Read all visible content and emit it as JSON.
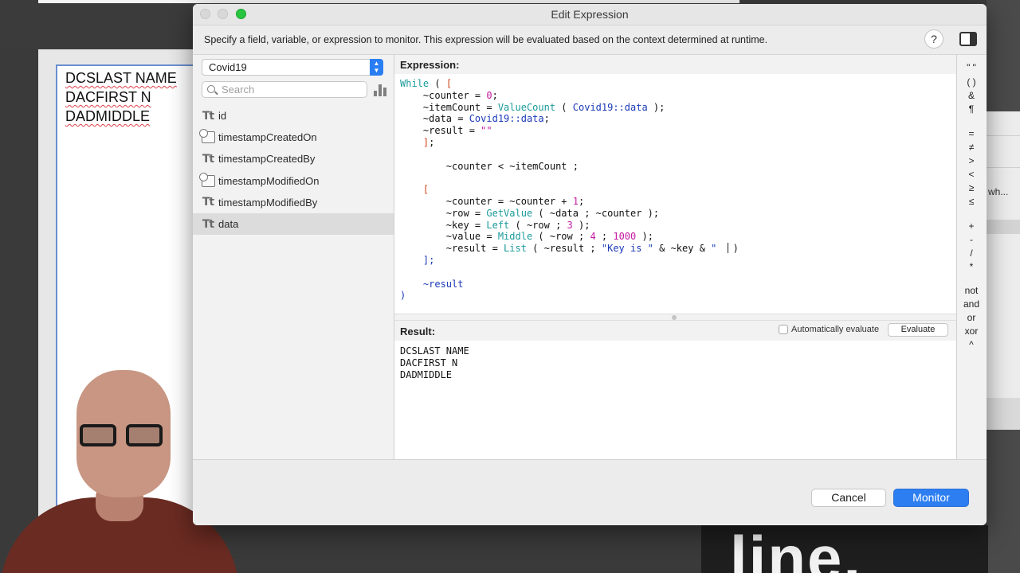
{
  "background": {
    "layout_lines": [
      "DCSLAST NAME",
      "DACFIRST N",
      "DADMIDDLE"
    ],
    "right_panel_text": "wh...",
    "big_text": "line."
  },
  "dialog": {
    "title": "Edit Expression",
    "instructions": "Specify a field, variable, or expression to monitor. This expression will be evaluated based on the context determined at runtime.",
    "help_label": "?",
    "table_selector": {
      "value": "Covid19"
    },
    "search": {
      "placeholder": "Search"
    },
    "fields": [
      {
        "name": "id",
        "type": "text",
        "selected": false
      },
      {
        "name": "timestampCreatedOn",
        "type": "timestamp",
        "selected": false
      },
      {
        "name": "timestampCreatedBy",
        "type": "text",
        "selected": false
      },
      {
        "name": "timestampModifiedOn",
        "type": "timestamp",
        "selected": false
      },
      {
        "name": "timestampModifiedBy",
        "type": "text",
        "selected": false
      },
      {
        "name": "data",
        "type": "text",
        "selected": true
      }
    ],
    "field_type_glyph": "Tt",
    "expression_label": "Expression:",
    "result_label": "Result:",
    "auto_evaluate_label": "Automatically evaluate",
    "auto_evaluate_checked": false,
    "evaluate_button": "Evaluate",
    "result_lines": [
      "DCSLAST NAME",
      "DACFIRST N",
      "DADMIDDLE"
    ],
    "operators": [
      "\" \"",
      "( )",
      "&",
      "¶",
      "=",
      "≠",
      ">",
      "<",
      "≥",
      "≤",
      "+",
      "-",
      "/",
      "*",
      "not",
      "and",
      "or",
      "xor",
      "^"
    ],
    "cancel_button": "Cancel",
    "monitor_button": "Monitor",
    "accent_color": "#2d7ff1"
  },
  "code_tokens": {
    "l1_while": "While",
    "l1_paren": " ( ",
    "l1_bracket": "[",
    "l2_a": "    ~counter = ",
    "l2_num": "0",
    "l2_b": ";",
    "l3_a": "    ~itemCount = ",
    "l3_fn": "ValueCount",
    "l3_b": " ( ",
    "l3_field": "Covid19::data",
    "l3_c": " );",
    "l4_a": "    ~data = ",
    "l4_field": "Covid19::data",
    "l4_b": ";",
    "l5_a": "    ~result = ",
    "l5_str": "\"\"",
    "l6_a": "    ",
    "l6_bracket": "]",
    "l6_b": ";",
    "l8": "        ~counter < ~itemCount ;",
    "l10_a": "    ",
    "l10_bracket": "[",
    "l11_a": "        ~counter = ~counter + ",
    "l11_num": "1",
    "l11_b": ";",
    "l12_a": "        ~row = ",
    "l12_fn": "GetValue",
    "l12_b": " ( ~data ; ~counter );",
    "l13_a": "        ~key = ",
    "l13_fn": "Left",
    "l13_b": " ( ~row ; ",
    "l13_num": "3",
    "l13_c": " );",
    "l14_a": "        ~value = ",
    "l14_fn": "Middle",
    "l14_b": " ( ~row ; ",
    "l14_num1": "4",
    "l14_c": " ; ",
    "l14_num2": "1000",
    "l14_d": " );",
    "l15_a": "        ~result = ",
    "l15_fn": "List",
    "l15_b": " ( ~result ; ",
    "l15_str1": "\"Key is \"",
    "l15_c": " & ~key & ",
    "l15_str2": "\" ",
    "l15_d": ")",
    "l16_a": "    ];",
    "l18_a": "    ",
    "l18_var": "~result",
    "l19_a": ")"
  }
}
